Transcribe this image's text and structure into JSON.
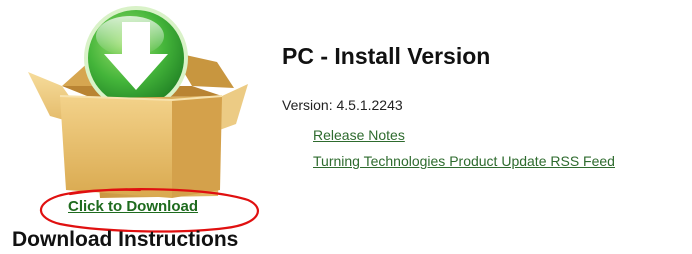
{
  "product": {
    "title": "PC - Install Version",
    "version_label": "Version:",
    "version_value": "4.5.1.2243"
  },
  "links": {
    "release_notes": "Release Notes",
    "rss_feed": "Turning Technologies Product Update RSS Feed"
  },
  "download": {
    "link_text": "Click to Download",
    "instructions_heading": "Download Instructions"
  },
  "colors": {
    "link_green": "#2e6b2e",
    "icon_green": "#3aa53a",
    "box_tan": "#e0b865",
    "annotation_red": "#e01010"
  },
  "icons": {
    "box": "open-box-icon",
    "download_arrow": "download-arrow-icon"
  }
}
